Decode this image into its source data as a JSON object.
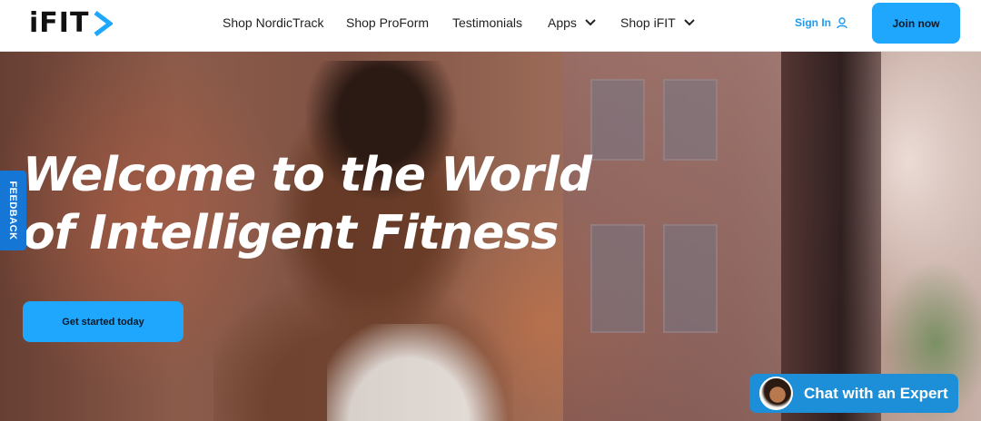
{
  "header": {
    "logo_text": "iFIT",
    "nav": [
      {
        "label": "Shop NordicTrack",
        "has_dropdown": false
      },
      {
        "label": "Shop ProForm",
        "has_dropdown": false
      },
      {
        "label": "Testimonials",
        "has_dropdown": false
      },
      {
        "label": "Apps",
        "has_dropdown": true
      },
      {
        "label": "Shop iFIT",
        "has_dropdown": true
      }
    ],
    "sign_in_label": "Sign In",
    "join_label": "Join now"
  },
  "hero": {
    "headline_line1": "Welcome to the World",
    "headline_line2": "of Intelligent Fitness",
    "cta_label": "Get started today"
  },
  "feedback": {
    "label": "FEEDBACK"
  },
  "chat": {
    "label": "Chat with an Expert"
  },
  "colors": {
    "accent": "#1ea7fd",
    "logo_chevron": "#1ea7fd",
    "feedback_tab": "#1576d6",
    "chat_widget": "#1c8fd8",
    "sign_in_text": "#1d9bf0"
  },
  "icons": {
    "logo_mark": "chevron-right-icon",
    "nav_dropdown": "chevron-down-icon",
    "sign_in": "user-icon"
  }
}
